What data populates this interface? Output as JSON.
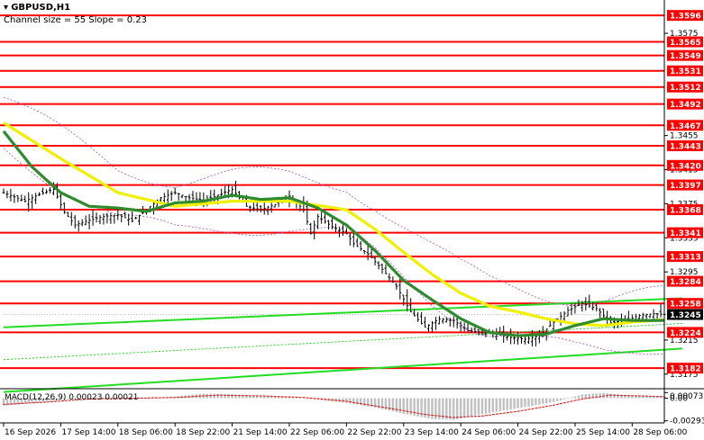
{
  "header": {
    "symbol": "GBPUSD,H1",
    "channel_info": "Channel size = 55 Slope = 0.23"
  },
  "macd": {
    "label": "MACD(12,26,9) 0.00023 0.00021",
    "ticks": [
      "0.00073",
      "0.00",
      "-0.00293"
    ]
  },
  "colors": {
    "level_line": "#ff0000",
    "level_tag": "#ff0000",
    "price_tag": "#000000",
    "ma_fast": "#2e8b2e",
    "ma_slow": "#f0f000",
    "channel": "#22dd22",
    "envelope": "#b04fd0",
    "candle": "#000000",
    "histogram": "#c0c0c0",
    "signal": "#e02020"
  },
  "chart_data": {
    "type": "line",
    "title": "GBPUSD,H1",
    "ylim": [
      1.316,
      1.3612
    ],
    "current_price": "1.3245",
    "price_ticks": [
      "1.3575",
      "1.3455",
      "1.3415",
      "1.3375",
      "1.3335",
      "1.3295",
      "1.3215",
      "1.3175"
    ],
    "levels": [
      "1.3596",
      "1.3565",
      "1.3549",
      "1.3531",
      "1.3512",
      "1.3492",
      "1.3467",
      "1.3443",
      "1.3420",
      "1.3397",
      "1.3368",
      "1.3341",
      "1.3313",
      "1.3284",
      "1.3258",
      "1.3224",
      "1.3182"
    ],
    "x_labels": [
      "16 Sep 2026",
      "17 Sep 14:00",
      "18 Sep 06:00",
      "18 Sep 22:00",
      "21 Sep 14:00",
      "22 Sep 06:00",
      "22 Sep 22:00",
      "23 Sep 14:00",
      "24 Sep 06:00",
      "24 Sep 22:00",
      "25 Sep 14:00",
      "28 Sep 06:00"
    ],
    "x_label_index": [
      0,
      16,
      32,
      48,
      64,
      80,
      96,
      112,
      128,
      144,
      160,
      176
    ],
    "n_bars": 186,
    "price_path": [
      [
        0,
        1.3388
      ],
      [
        6,
        1.3378
      ],
      [
        10,
        1.3386
      ],
      [
        14,
        1.3392
      ],
      [
        17,
        1.3365
      ],
      [
        20,
        1.335
      ],
      [
        24,
        1.3356
      ],
      [
        28,
        1.336
      ],
      [
        32,
        1.3362
      ],
      [
        36,
        1.3355
      ],
      [
        40,
        1.3368
      ],
      [
        44,
        1.3382
      ],
      [
        48,
        1.3388
      ],
      [
        52,
        1.3382
      ],
      [
        56,
        1.3379
      ],
      [
        60,
        1.3385
      ],
      [
        64,
        1.3392
      ],
      [
        68,
        1.3372
      ],
      [
        72,
        1.3368
      ],
      [
        76,
        1.3374
      ],
      [
        80,
        1.3384
      ],
      [
        84,
        1.3368
      ],
      [
        86,
        1.334
      ],
      [
        88,
        1.336
      ],
      [
        92,
        1.3348
      ],
      [
        96,
        1.334
      ],
      [
        98,
        1.3328
      ],
      [
        102,
        1.3316
      ],
      [
        106,
        1.3298
      ],
      [
        110,
        1.3278
      ],
      [
        114,
        1.3248
      ],
      [
        118,
        1.323
      ],
      [
        122,
        1.324
      ],
      [
        126,
        1.3238
      ],
      [
        130,
        1.3226
      ],
      [
        134,
        1.3224
      ],
      [
        138,
        1.3222
      ],
      [
        142,
        1.3218
      ],
      [
        146,
        1.3216
      ],
      [
        150,
        1.322
      ],
      [
        154,
        1.3236
      ],
      [
        158,
        1.325
      ],
      [
        162,
        1.3258
      ],
      [
        166,
        1.3252
      ],
      [
        170,
        1.3235
      ],
      [
        174,
        1.3238
      ],
      [
        178,
        1.3244
      ],
      [
        182,
        1.3246
      ],
      [
        185,
        1.3245
      ]
    ],
    "ma_fast_path": [
      [
        0,
        1.346
      ],
      [
        8,
        1.3418
      ],
      [
        16,
        1.3388
      ],
      [
        24,
        1.3372
      ],
      [
        32,
        1.337
      ],
      [
        40,
        1.3366
      ],
      [
        48,
        1.3376
      ],
      [
        56,
        1.3378
      ],
      [
        64,
        1.3385
      ],
      [
        72,
        1.338
      ],
      [
        80,
        1.3382
      ],
      [
        88,
        1.337
      ],
      [
        96,
        1.335
      ],
      [
        104,
        1.332
      ],
      [
        112,
        1.3285
      ],
      [
        120,
        1.3262
      ],
      [
        128,
        1.324
      ],
      [
        136,
        1.3224
      ],
      [
        144,
        1.322
      ],
      [
        152,
        1.3222
      ],
      [
        160,
        1.3232
      ],
      [
        168,
        1.324
      ],
      [
        176,
        1.3238
      ],
      [
        185,
        1.3238
      ]
    ],
    "ma_slow_path": [
      [
        0,
        1.347
      ],
      [
        16,
        1.3428
      ],
      [
        32,
        1.3388
      ],
      [
        48,
        1.3372
      ],
      [
        64,
        1.3378
      ],
      [
        80,
        1.3378
      ],
      [
        96,
        1.3368
      ],
      [
        104,
        1.3345
      ],
      [
        112,
        1.3318
      ],
      [
        120,
        1.3292
      ],
      [
        128,
        1.327
      ],
      [
        136,
        1.3255
      ],
      [
        144,
        1.3248
      ],
      [
        152,
        1.324
      ],
      [
        160,
        1.3234
      ],
      [
        168,
        1.3232
      ],
      [
        176,
        1.3236
      ],
      [
        185,
        1.3239
      ]
    ],
    "channel": {
      "lower": [
        [
          0,
          1.3154
        ],
        [
          190,
          1.3205
        ]
      ],
      "upper": [
        [
          0,
          1.323
        ],
        [
          190,
          1.3264
        ]
      ]
    },
    "macd_ylim": [
      -0.0032,
      0.001
    ],
    "macd_hist_path": [
      [
        0,
        -0.001
      ],
      [
        10,
        -0.0005
      ],
      [
        16,
        -0.0002
      ],
      [
        24,
        0.0001
      ],
      [
        32,
        0.0001
      ],
      [
        40,
        -0.0001
      ],
      [
        48,
        0.0002
      ],
      [
        56,
        0.0006
      ],
      [
        64,
        0.0005
      ],
      [
        72,
        0.0003
      ],
      [
        80,
        0.0002
      ],
      [
        88,
        -0.0002
      ],
      [
        96,
        -0.0006
      ],
      [
        104,
        -0.0012
      ],
      [
        112,
        -0.002
      ],
      [
        120,
        -0.0027
      ],
      [
        126,
        -0.0028
      ],
      [
        132,
        -0.0022
      ],
      [
        140,
        -0.0016
      ],
      [
        148,
        -0.001
      ],
      [
        156,
        -0.0003
      ],
      [
        162,
        0.0005
      ],
      [
        168,
        0.0007
      ],
      [
        174,
        0.0004
      ],
      [
        180,
        0.0002
      ],
      [
        185,
        0.0002
      ]
    ],
    "macd_signal_path": [
      [
        0,
        -0.0008
      ],
      [
        12,
        -0.0005
      ],
      [
        24,
        -0.0001
      ],
      [
        36,
        0.0
      ],
      [
        48,
        0.0001
      ],
      [
        60,
        0.0004
      ],
      [
        72,
        0.0003
      ],
      [
        84,
        0.0001
      ],
      [
        96,
        -0.0004
      ],
      [
        108,
        -0.0013
      ],
      [
        118,
        -0.0021
      ],
      [
        126,
        -0.0025
      ],
      [
        134,
        -0.0023
      ],
      [
        144,
        -0.0017
      ],
      [
        154,
        -0.0009
      ],
      [
        162,
        -0.0001
      ],
      [
        170,
        0.0004
      ],
      [
        178,
        0.0003
      ],
      [
        185,
        0.0002
      ]
    ]
  }
}
